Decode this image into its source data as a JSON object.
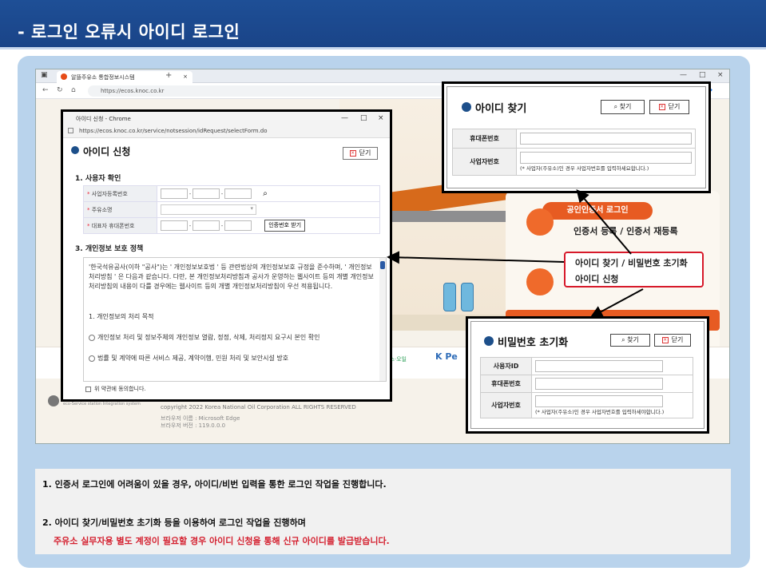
{
  "slide": {
    "title": "-  로그인 오류시 아이디 로그인"
  },
  "browser": {
    "tab_title": "알뜰주유소 통합정보시스템",
    "tab_close": "×",
    "new_tab": "+",
    "url": "https://ecos.knoc.co.kr",
    "minimize": "—",
    "maximize": "□",
    "close": "×"
  },
  "site": {
    "cert_login_button": "공인인증서 로그인",
    "cert_register": "인증서 등록 / 인증서 재등록",
    "date_fragment": "02",
    "partner_logo": "K Pe",
    "partner_logo2": "엔스·오일",
    "copyright": "copyright 2022 Korea National Oil Corporation ALL RIGHTS RESERVED",
    "browser_name": "브라우저 이름 : Microsoft Edge",
    "browser_version": "브라우저 버전 : 119.0.0.0",
    "footer_small": "eco-Service station Integration system"
  },
  "highlight": {
    "line1": "아이디 찾기 / 비밀번호 초기화",
    "line2": "아이디 신청"
  },
  "popup_apply": {
    "window_title": "아이디 신청 - Chrome",
    "window_url": "https://ecos.knoc.co.kr/service/notsession/idRequest/selectForm.do",
    "heading": "아이디 신청",
    "close_label": "닫기",
    "section1": "1. 사용자 확인",
    "fields": [
      {
        "label": "사업자등록번호"
      },
      {
        "label": "주유소명"
      },
      {
        "label": "대표자 휴대폰번호"
      }
    ],
    "auth_button": "인증번호 받기",
    "section3": "3. 개인정보 보호 정책",
    "privacy_text": "'한국석유공사(이하 \"공사\")는 ' 개인정보보호법 ' 등 관련법상의 개인정보보호 규정을 준수하며, ' 개인정보처리방침 ' 은 다음과 같습니다. 다만, 본 개인정보처리방침과 공사가 운영하는 웹사이트 등의 개별 개인정보처리방침의 내용이 다를 경우에는 웹사이트 등의 개별 개인정보처리방침이 우선 적용됩니다.",
    "privacy_item1": "1. 개인정보의 처리 목적",
    "privacy_radio1": "개인정보 처리 및 정보주체의 개인정보 열람, 정정, 삭제, 처리정지 요구시 본인 확인",
    "privacy_radio2": "법률 및 계약에 따른 서비스 제공, 계약이행, 민원 처리 및 보안시설 방호",
    "agree_label": "위 약관에 동의합니다."
  },
  "popup_find": {
    "heading": "아이디 찾기",
    "search_label": "찾기",
    "close_label": "닫기",
    "rows": [
      {
        "label": "휴대폰번호"
      },
      {
        "label": "사업자번호"
      }
    ],
    "hint": "(* 사업자(주유소)인 경우 사업자번호를 입력하세요합니다.)"
  },
  "popup_reset": {
    "heading": "비밀번호 초기화",
    "search_label": "찾기",
    "close_label": "닫기",
    "rows": [
      {
        "label": "사용자ID"
      },
      {
        "label": "휴대폰번호"
      },
      {
        "label": "사업자번호"
      }
    ],
    "hint": "(* 사업자(주유소)인 경우 사업자번호를 입력하세야합니다.)"
  },
  "notes": {
    "line1": "1. 인증서 로그인에 어려움이 있을 경우, 아이디/비번 입력을 통한 로그인 작업을 진행합니다.",
    "line2": "2. 아이디 찾기/비밀번호 초기화 등을 이용하여 로그인 작업을 진행하며",
    "line3": "주유소 실무자용 별도 계정이 필요할 경우 아이디 신청을 통해 신규 아이디를 발급받습니다."
  },
  "colors": {
    "header_bg": "#1e4f96",
    "panel_bg": "#b9d3ec",
    "accent_orange": "#e75b22",
    "highlight_red": "#d7192a",
    "note_red": "#d4202f"
  }
}
